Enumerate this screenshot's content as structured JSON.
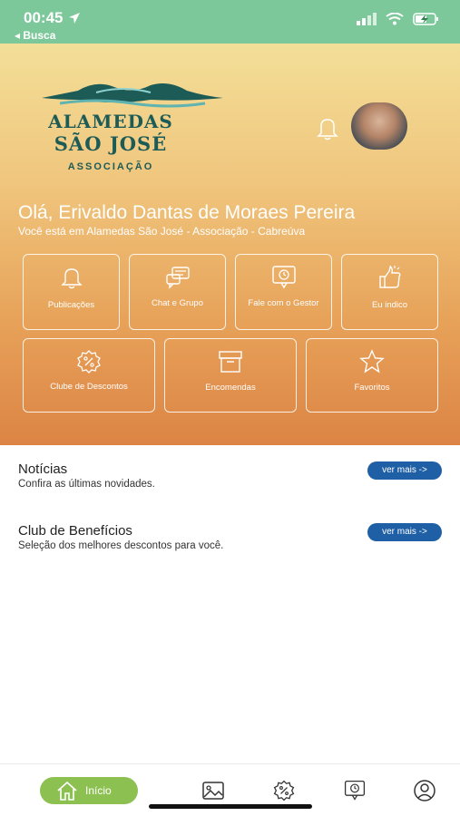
{
  "status": {
    "time": "00:45",
    "back_label": "◂ Busca"
  },
  "logo": {
    "line1": "ALAMEDAS",
    "line2": "SÃO JOSÉ",
    "line3": "ASSOCIAÇÃO"
  },
  "greeting": "Olá, Erivaldo Dantas de Moraes Pereira",
  "location": "Você está em Alamedas São José - Associação - Cabreúva",
  "tiles": [
    {
      "label": "Publicações",
      "icon": "bell-icon"
    },
    {
      "label": "Chat e Grupo",
      "icon": "chat-icon"
    },
    {
      "label": "Fale com o Gestor",
      "icon": "clock-chat-icon"
    },
    {
      "label": "Eu indico",
      "icon": "thumbs-up-icon"
    },
    {
      "label": "Clube de Descontos",
      "icon": "discount-badge-icon"
    },
    {
      "label": "Encomendas",
      "icon": "package-icon"
    },
    {
      "label": "Favoritos",
      "icon": "star-icon"
    }
  ],
  "sections": [
    {
      "title": "Notícias",
      "subtitle": "Confira as últimas novidades.",
      "button": "ver mais ->"
    },
    {
      "title": "Club de Benefícios",
      "subtitle": "Seleção dos melhores descontos para você.",
      "button": "ver mais ->"
    }
  ],
  "tabbar": {
    "home_label": "Início",
    "items": [
      "home-icon",
      "image-icon",
      "discount-badge-icon",
      "clock-chat-icon",
      "user-icon"
    ]
  },
  "colors": {
    "status_bar": "#7cc89a",
    "hero_top": "#f3df98",
    "hero_bottom": "#dc8445",
    "pill": "#1f5fa5",
    "tab_active": "#8cc152"
  }
}
